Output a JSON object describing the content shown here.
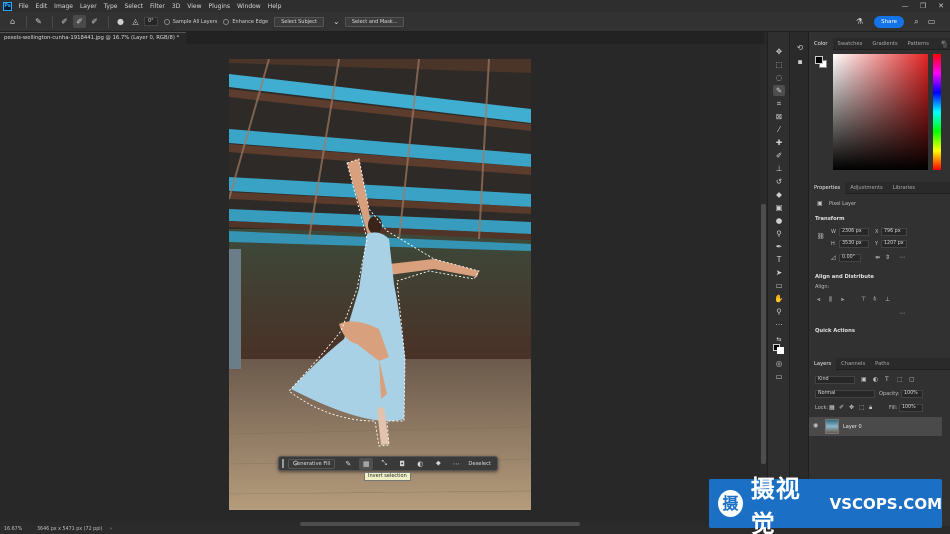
{
  "menu": {
    "app_icon": "Ps",
    "items": [
      "File",
      "Edit",
      "Image",
      "Layer",
      "Type",
      "Select",
      "Filter",
      "3D",
      "View",
      "Plugins",
      "Window",
      "Help"
    ],
    "window_controls": [
      "—",
      "❐",
      "✕"
    ]
  },
  "options": {
    "angle": "0°",
    "sample_all_layers": "Sample All Layers",
    "enhance_edge": "Enhance Edge",
    "select_subject": "Select Subject",
    "select_and_mask": "Select and Mask...",
    "share": "Share"
  },
  "document": {
    "tab_title": "pexels-wellington-cunha-1918441.jpg @ 16.7% (Layer 0, RGB/8) *"
  },
  "taskbar": {
    "generative_fill": "Generative Fill",
    "deselect": "Deselect",
    "tooltip": "Invert selection"
  },
  "status": {
    "zoom": "16.67%",
    "dimensions": "3646 px x 5471 px (72 ppi)",
    "arrow": "›"
  },
  "color_panel": {
    "tabs": [
      "Color",
      "Swatches",
      "Gradients",
      "Patterns"
    ],
    "foreground": "#000000",
    "background": "#ffffff"
  },
  "properties": {
    "tabs": [
      "Properties",
      "Adjustments",
      "Libraries"
    ],
    "layer_type": "Pixel Layer",
    "transform_title": "Transform",
    "w_label": "W",
    "w_value": "2306 px",
    "x_label": "X",
    "x_value": "796 px",
    "h_label": "H",
    "h_value": "3530 px",
    "y_label": "Y",
    "y_value": "1207 px",
    "angle_value": "0.00°",
    "align_title": "Align and Distribute",
    "align_label": "Align:",
    "quick_actions_title": "Quick Actions"
  },
  "layers": {
    "tabs": [
      "Layers",
      "Channels",
      "Paths"
    ],
    "kind": "Kind",
    "blend_mode": "Normal",
    "opacity_label": "Opacity:",
    "opacity_value": "100%",
    "lock_label": "Lock:",
    "fill_label": "Fill:",
    "fill_value": "100%",
    "layer_name": "Layer 0"
  },
  "watermark": {
    "logo_char": "摄",
    "chinese": "摄视觉",
    "english": "VSCOPS.COM"
  }
}
